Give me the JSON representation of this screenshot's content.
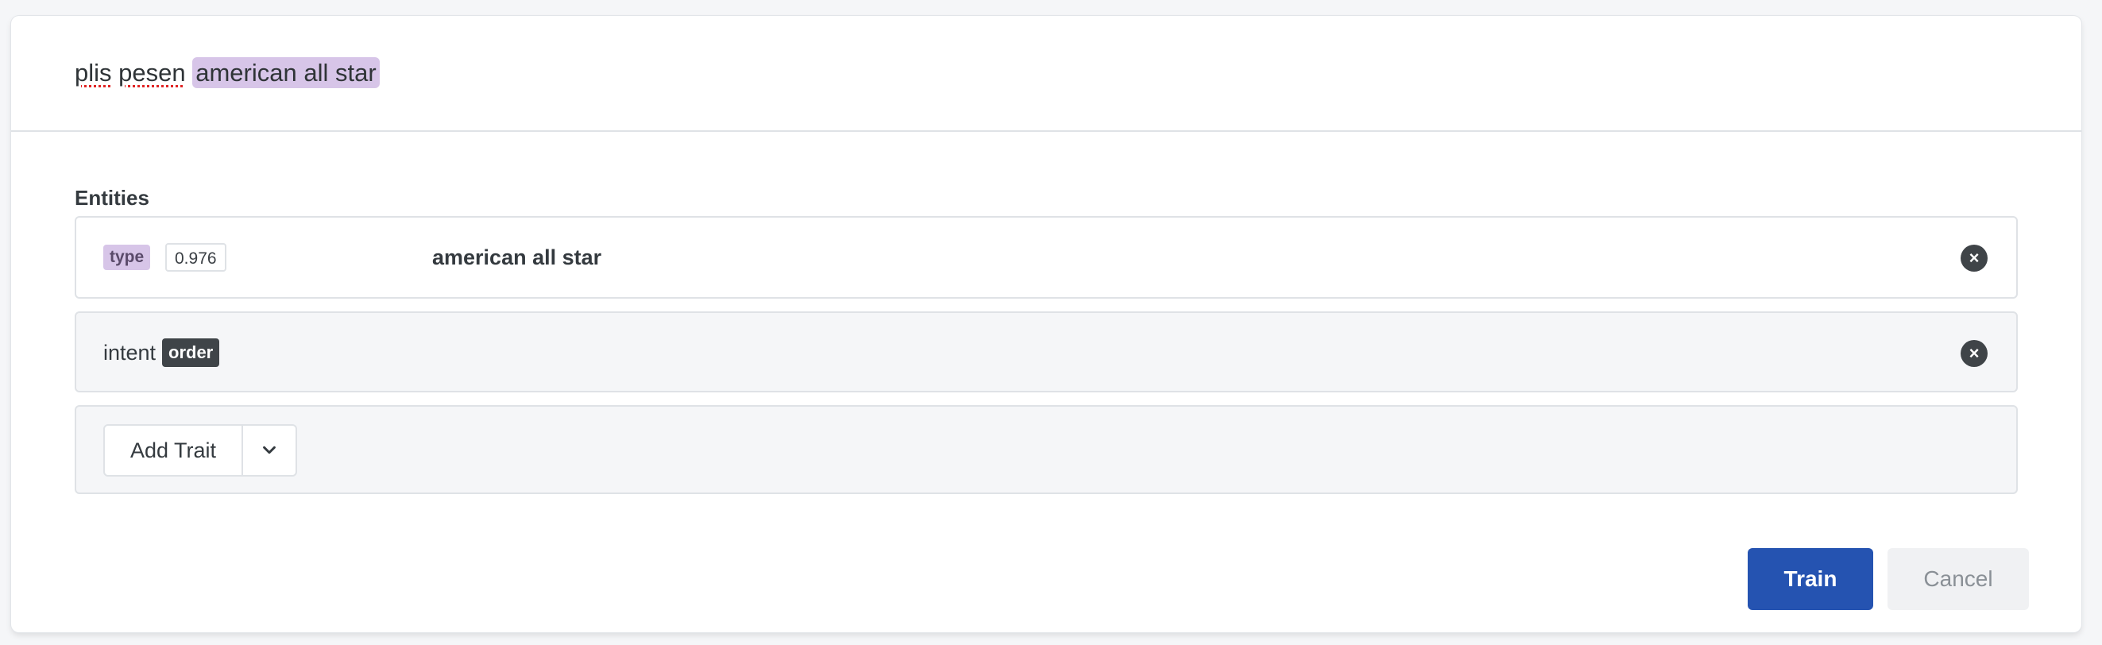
{
  "utterance": {
    "word1": "plis",
    "word2": "pesen",
    "highlight": "american all star"
  },
  "entities": {
    "title": "Entities",
    "items": [
      {
        "tag": "type",
        "score": "0.976",
        "value": "american all star",
        "tag_color": "#d7c5e8"
      }
    ]
  },
  "traits": [
    {
      "name": "intent",
      "value": "order"
    }
  ],
  "add_trait": {
    "label": "Add Trait",
    "toggle_icon": "chevron-down-icon"
  },
  "actions": {
    "train_label": "Train",
    "cancel_label": "Cancel",
    "primary_color": "#2553b1"
  },
  "icons": {
    "close": "close-icon"
  }
}
